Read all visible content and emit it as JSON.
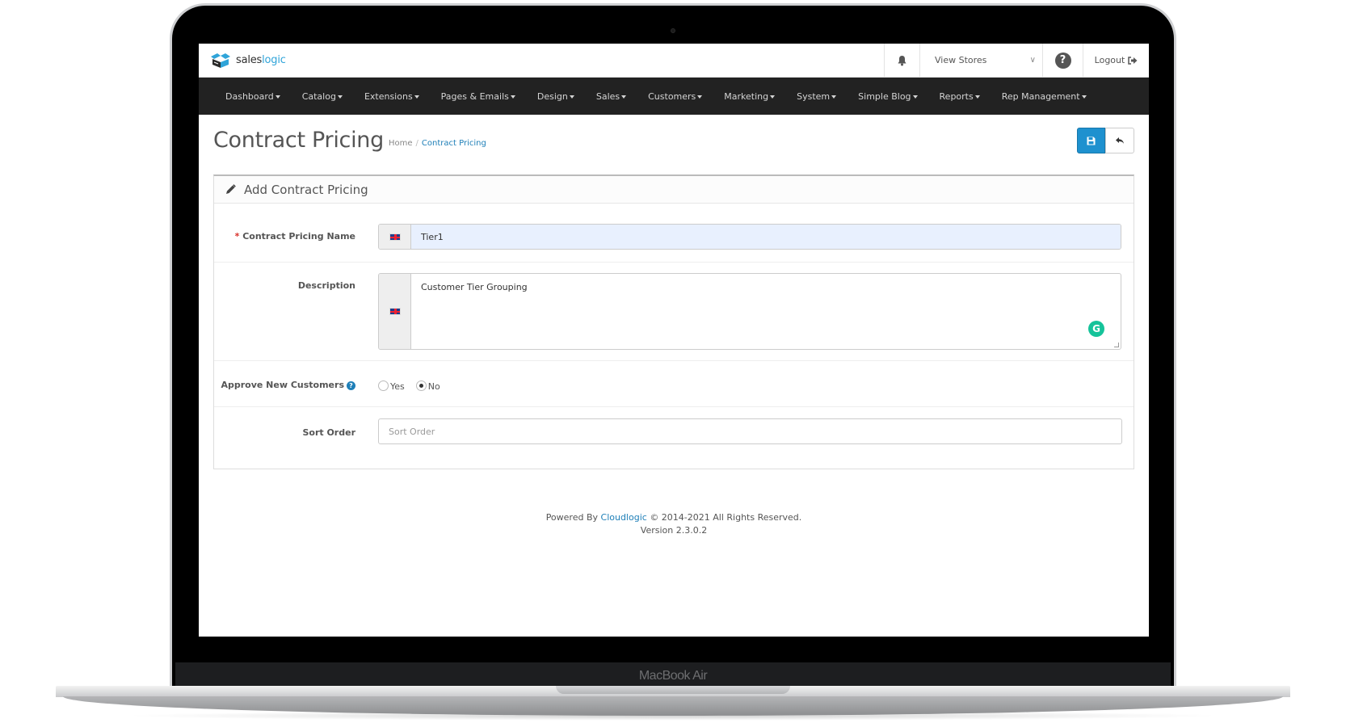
{
  "device": {
    "label": "MacBook Air"
  },
  "header": {
    "brand_prefix": "sales",
    "brand_suffix": "logic",
    "view_stores_label": "View Stores",
    "logout_label": "Logout"
  },
  "nav": {
    "items": [
      {
        "label": "Dashboard"
      },
      {
        "label": "Catalog"
      },
      {
        "label": "Extensions"
      },
      {
        "label": "Pages & Emails"
      },
      {
        "label": "Design"
      },
      {
        "label": "Sales"
      },
      {
        "label": "Customers"
      },
      {
        "label": "Marketing"
      },
      {
        "label": "System"
      },
      {
        "label": "Simple Blog"
      },
      {
        "label": "Reports"
      },
      {
        "label": "Rep Management"
      }
    ]
  },
  "page": {
    "title": "Contract Pricing",
    "breadcrumb": [
      {
        "label": "Home"
      },
      {
        "label": "Contract Pricing"
      }
    ],
    "separator": "/"
  },
  "form": {
    "heading": "Add Contract Pricing",
    "required_marker": "*",
    "name_label": "Contract Pricing Name",
    "name_value": "Tier1",
    "description_label": "Description",
    "description_value": "Customer Tier Grouping",
    "approve_label": "Approve New Customers",
    "approve_options": [
      {
        "label": "Yes",
        "checked": false
      },
      {
        "label": "No",
        "checked": true
      }
    ],
    "sort_label": "Sort Order",
    "sort_placeholder": "Sort Order",
    "sort_value": ""
  },
  "footer": {
    "powered_by": "Powered By",
    "company": "Cloudlogic",
    "copyright": "© 2014-2021 All Rights Reserved.",
    "version": "Version 2.3.0.2"
  },
  "colors": {
    "accent": "#1e91cf",
    "link": "#1e7fb8",
    "navbar": "#222222",
    "required": "#d9312b",
    "autofill": "#e8f0fe",
    "grammarly": "#15c39a"
  }
}
